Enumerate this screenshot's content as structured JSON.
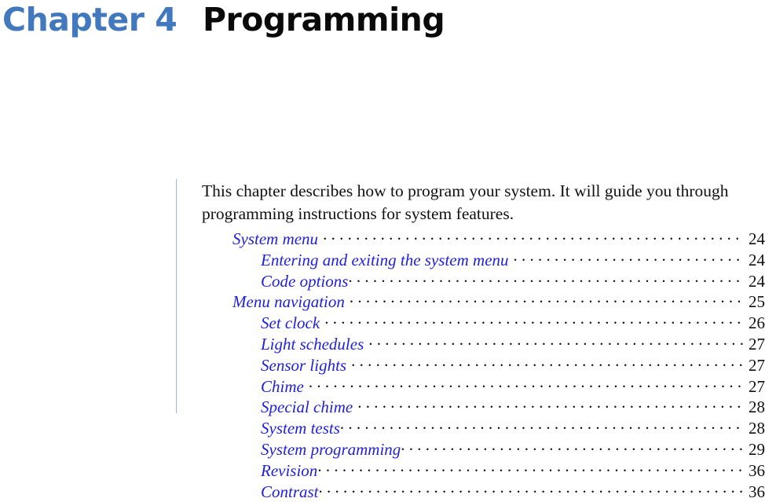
{
  "chapter": {
    "label": "Chapter 4",
    "title": "Programming",
    "accent_color": "#4178be",
    "title_color": "#0a0a0a"
  },
  "intro": {
    "text": "This chapter describes how to program your system. It will guide you through programming instructions for system features."
  },
  "toc": {
    "link_color": "#2020e0",
    "leader_color": "#111111",
    "entries": [
      {
        "title": "System menu",
        "page": "24",
        "level": 1,
        "tight": false
      },
      {
        "title": "Entering and exiting the system menu",
        "page": "24",
        "level": 2,
        "tight": false
      },
      {
        "title": "Code options",
        "page": "24",
        "level": 2,
        "tight": true
      },
      {
        "title": "Menu navigation",
        "page": "25",
        "level": 1,
        "tight": false
      },
      {
        "title": "Set clock",
        "page": "26",
        "level": 2,
        "tight": false
      },
      {
        "title": "Light schedules",
        "page": "27",
        "level": 2,
        "tight": false
      },
      {
        "title": "Sensor lights",
        "page": "27",
        "level": 2,
        "tight": false
      },
      {
        "title": "Chime",
        "page": "27",
        "level": 2,
        "tight": false
      },
      {
        "title": "Special chime",
        "page": "28",
        "level": 2,
        "tight": false
      },
      {
        "title": "System tests",
        "page": "28",
        "level": 2,
        "tight": true
      },
      {
        "title": "System programming",
        "page": "29",
        "level": 2,
        "tight": true
      },
      {
        "title": "Revision",
        "page": "36",
        "level": 2,
        "tight": true
      },
      {
        "title": "Contrast",
        "page": "36",
        "level": 2,
        "tight": true
      }
    ]
  }
}
